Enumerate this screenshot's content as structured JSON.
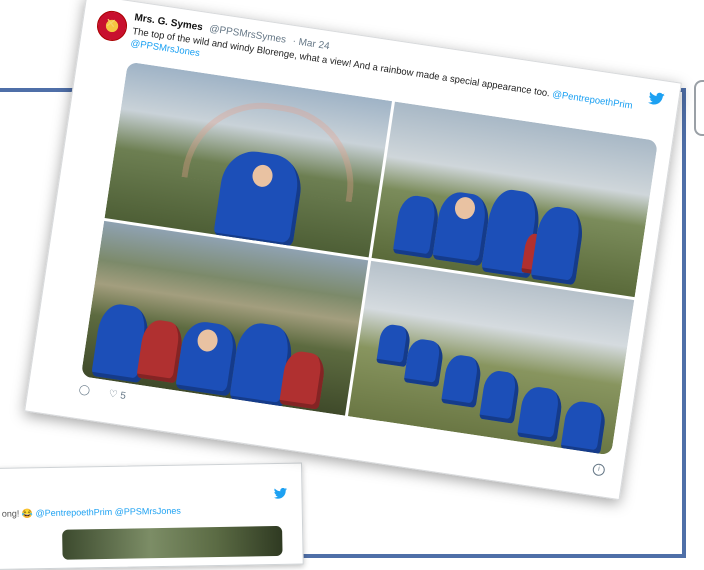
{
  "main_tweet": {
    "author_name": "Mrs. G. Symes",
    "author_handle": "@PPSMrsSymes",
    "date": "· Mar 24",
    "text": "The top of the wild and windy Blorenge, what a view! And a rainbow made a special appearance too.",
    "mention_1": "@PentrepoethPrim",
    "mention_2": "@PPSMrsJones",
    "reply_count": "",
    "like_count": "5"
  },
  "second_tweet": {
    "text_start": "ong! 😂",
    "mention_1": "@PentrepoethPrim",
    "mention_2": "@PPSMrsJones"
  },
  "icons": {
    "avatar": "school-crest-icon",
    "bird": "twitter-bird-icon",
    "reply": "reply-icon",
    "like": "heart-icon",
    "info": "info-icon"
  },
  "colors": {
    "frame_border": "#4f6fa8",
    "twitter_blue": "#1da1f2"
  }
}
